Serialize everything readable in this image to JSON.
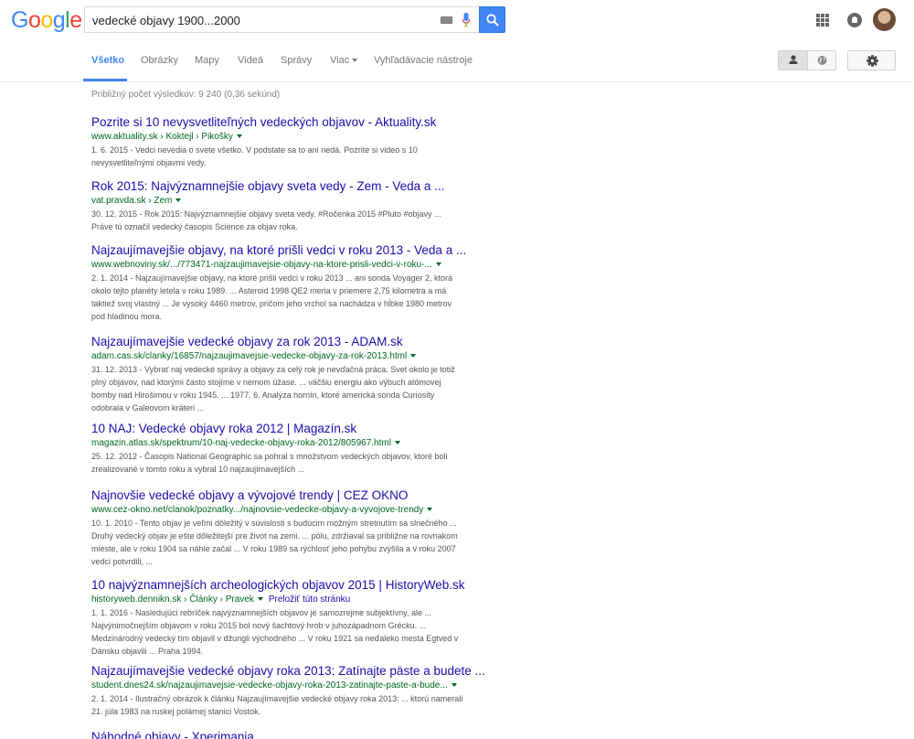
{
  "logo": {
    "letters": [
      "G",
      "o",
      "o",
      "g",
      "l",
      "e"
    ],
    "colors": [
      "#4285f4",
      "#ea4335",
      "#fbbc05",
      "#4285f4",
      "#34a853",
      "#ea4335"
    ]
  },
  "search": {
    "query": "vedecké objavy 1900...2000"
  },
  "nav": {
    "tabs": [
      "Všetko",
      "Obrázky",
      "Mapy",
      "Videá",
      "Správy",
      "Viac",
      "Vyhľadávacie nástroje"
    ]
  },
  "stats": "Približný počet výsledkov: 9 240 (0,36 sekúnd)",
  "results": [
    {
      "title": "Pozrite si 10 nevysvetliteľných vedeckých objavov - Aktuality.sk",
      "url": "www.aktuality.sk › Koktejl › Pikošky",
      "translate": "",
      "snippet": [
        "1. 6. 2015 - Vedci nevedia o svete všetko. V podstate sa to ani nedá. Pozrite si video s 10",
        "nevysvetliteľnými objavmi vedy."
      ]
    },
    {
      "title": "Rok 2015: Najvýznamnejšie objavy sveta vedy - Zem - Veda a ...",
      "url": "vat.pravda.sk › Zem",
      "translate": "",
      "snippet": [
        "30. 12. 2015 - Rok 2015: Najvýznamnejšie objavy sveta vedy. #Ročenka 2015 #Pluto #objavy ...",
        "Práve tú označil vedecký časopis Science za objav roka."
      ]
    },
    {
      "title": "Najzaujímavejšie objavy, na ktoré prišli vedci v roku 2013 - Veda a ...",
      "url": "www.webnoviny.sk/.../773471-najzaujimavejsie-objavy-na-ktore-prisli-vedci-v-roku-...",
      "translate": "",
      "snippet": [
        "2. 1. 2014 - Najzaujímavejšie objavy, na ktoré prišli vedci v roku 2013 ... ani sonda Voyager 2, ktorá",
        "okolo tejto planéty letela v roku 1989. ... Asteroid 1998 QE2 meria v priemere 2,75 kilometra a má",
        "taktiež svoj vlastný ... Je vysoký 4460 metrov, pričom jeho vrchol sa nachádza v hĺbke 1980 metrov",
        "pod hladinou mora."
      ]
    },
    {
      "title": "Najzaujímavejšie vedecké objavy za rok 2013 - ADAM.sk",
      "url": "adam.cas.sk/clanky/16857/najzaujimavejsie-vedecke-objavy-za-rok-2013.html",
      "translate": "",
      "snippet": [
        "31. 12. 2013 - Vybrať naj vedecké správy a objavy za celý rok je nevďačná práca. Svet okolo je totiž",
        "plný objavov, nad ktorými často stojíme v nemom úžase. ... väčšiu energiu ako výbuch atómovej",
        "bomby nad Hirošimou v roku 1945. ... 1977. 6. Analýza hornín, ktoré americká sonda Curiosity",
        "odobrala v Galeovom kráteri ..."
      ]
    },
    {
      "title": "10 NAJ: Vedecké objavy roka 2012 | Magazín.sk",
      "url": "magazin.atlas.sk/spektrum/10-naj-vedecke-objavy-roka-2012/805967.html",
      "translate": "",
      "snippet": [
        "25. 12. 2012 - Časopis National Geographic sa pohral s množstvom vedeckých objavov, ktoré boli",
        "zrealizované v tomto roku a vybral 10 najzaujímavejších ..."
      ]
    },
    {
      "title": "Najnovšie vedecké objavy a vývojové trendy | CEZ OKNO",
      "url": "www.cez-okno.net/clanok/poznatky.../najnovsie-vedecke-objavy-a-vyvojove-trendy",
      "translate": "",
      "snippet": [
        "10. 1. 2010 - Tento objav je veľmi dôležitý v súvislosti s budúcim možným stretnutím sa slnečného ...",
        "Druhý vedecký objav je ešte dôležitejší pre život na zemi. ... pólu, zdržiaval sa približne na rovnakom",
        "mieste, ale v roku 1904 sa náhle začal ... V roku 1989 sa rýchlosť jeho pohybu zvýšila a v roku 2007",
        "vedci potvrdili, ..."
      ]
    },
    {
      "title": "10 najvýznamnejších archeologických objavov 2015 | HistoryWeb.sk",
      "url": "historyweb.dennikn.sk › Články › Pravek",
      "translate": "Preložiť túto stránku",
      "snippet": [
        "1. 1. 2016 - Nasledujúci rebríček najvýznamnejších objavov je samozrejme subjektívny, ale ...",
        "Najvýnimočnejším objavom v roku 2015 bol nový šachtový hrob v juhozápadnom Grécku. ...",
        "Medzinárodný vedecký tím objavil v džungli východného ... V roku 1921 sa neďaleko mesta Egtved v",
        "Dánsku objavili ... Praha 1994."
      ]
    },
    {
      "title": "Najzaujímavejšie vedecké objavy roka 2013: Zatínajte päste a budete ...",
      "url": "student.dnes24.sk/najzaujimavejsie-vedecke-objavy-roka-2013-zatinajte-paste-a-bude...",
      "translate": "",
      "snippet": [
        "2. 1. 2014 - Ilustračný obrázok k článku Najzaujímavejšie vedecké objavy roka 2013: ... ktorú namerali",
        "21. júla 1983 na ruskej polárnej stanici Vostok."
      ]
    },
    {
      "title": "Náhodné objavy - Xperimania",
      "url": "",
      "translate": "",
      "snippet": []
    }
  ]
}
